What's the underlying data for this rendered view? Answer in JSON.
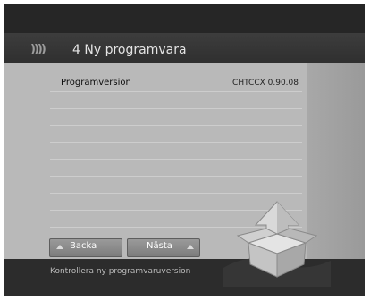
{
  "header": {
    "chevrons": "))))",
    "title": "4 Ny programvara"
  },
  "list": {
    "rows": [
      {
        "label": "Programversion",
        "value": "CHTCCX 0.90.08"
      },
      {
        "label": "",
        "value": ""
      },
      {
        "label": "",
        "value": ""
      },
      {
        "label": "",
        "value": ""
      },
      {
        "label": "",
        "value": ""
      },
      {
        "label": "",
        "value": ""
      },
      {
        "label": "",
        "value": ""
      },
      {
        "label": "",
        "value": ""
      },
      {
        "label": "",
        "value": ""
      }
    ]
  },
  "buttons": {
    "back_label": "Backa",
    "next_label": "Nästa"
  },
  "status": {
    "message": "Kontrollera ny programvaruversion"
  },
  "icons": {
    "title": "chevron-right-icon",
    "back": "triangle-up-icon",
    "next": "triangle-up-icon",
    "logo": "update-box-arrow-icon"
  }
}
